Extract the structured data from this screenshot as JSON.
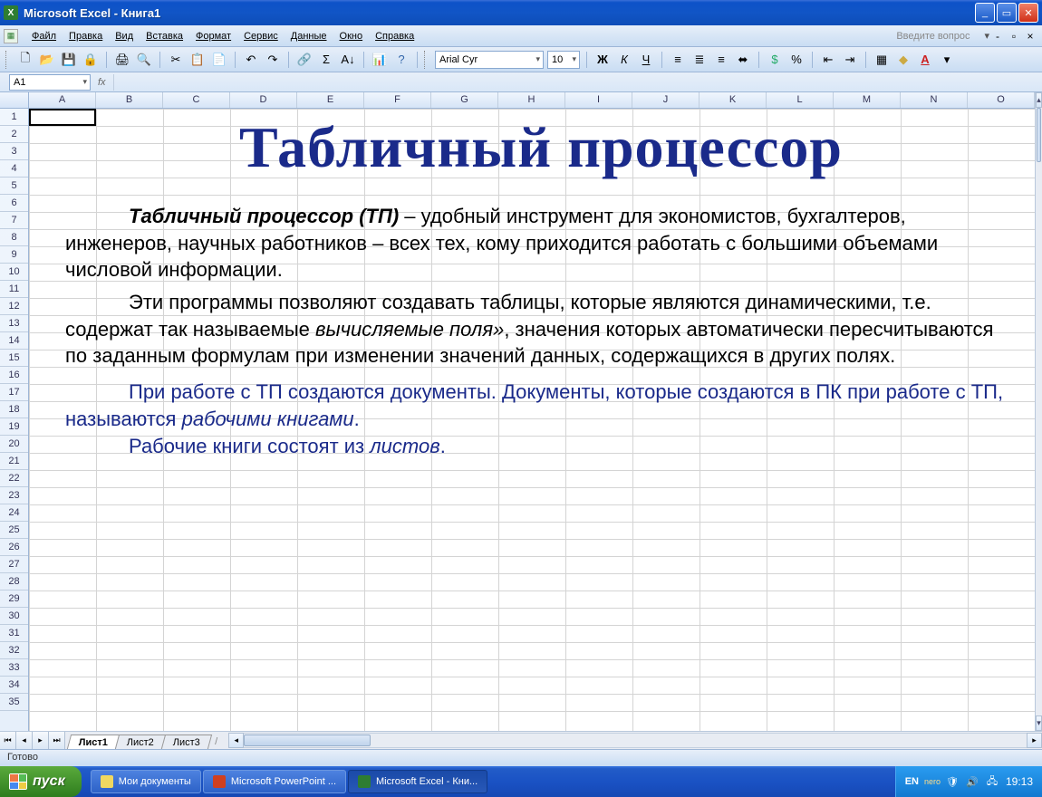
{
  "titlebar": {
    "title": "Microsoft Excel - Книга1"
  },
  "menubar": {
    "items": [
      "Файл",
      "Правка",
      "Вид",
      "Вставка",
      "Формат",
      "Сервис",
      "Данные",
      "Окно",
      "Справка"
    ],
    "ask": "Введите вопрос"
  },
  "toolbar": {
    "font": "Arial Cyr",
    "size": "10",
    "bold": "Ж",
    "italic": "К",
    "underline": "Ч",
    "currency": "%",
    "sigma": "Σ"
  },
  "formula_bar": {
    "name_box": "A1",
    "fx": "fx"
  },
  "columns": [
    "A",
    "B",
    "C",
    "D",
    "E",
    "F",
    "G",
    "H",
    "I",
    "J",
    "K",
    "L",
    "M",
    "N",
    "O"
  ],
  "row_count": 35,
  "content": {
    "title": "Табличный процессор",
    "p1_lead": "Табличный процессор (ТП)",
    "p1_rest": " – удобный инструмент для экономистов, бухгалтеров, инженеров, научных работников – всех тех, кому приходится работать с большими объемами числовой информации.",
    "p2_a": "Эти программы позволяют создавать таблицы, которые являются динамическими, т.е. содержат так называемые ",
    "p2_ital": "вычисляемые поля»",
    "p2_b": ", значения которых  автоматически пересчитываются по заданным формулам при изменении значений данных, содержащихся в других полях.",
    "p3_a": "При работе с ТП создаются документы. Документы, которые создаются в ПК при работе с ТП, называются ",
    "p3_ital": "рабочими книгами",
    "p3_b": ".",
    "p4_a": "Рабочие книги состоят из ",
    "p4_ital": "листов",
    "p4_b": "."
  },
  "sheet_tabs": [
    "Лист1",
    "Лист2",
    "Лист3"
  ],
  "statusbar": {
    "text": "Готово"
  },
  "taskbar": {
    "start": "пуск",
    "items": [
      "Мои документы",
      "Microsoft PowerPoint ...",
      "Microsoft Excel - Кни..."
    ],
    "lang": "EN",
    "nero": "nero",
    "clock": "19:13"
  }
}
